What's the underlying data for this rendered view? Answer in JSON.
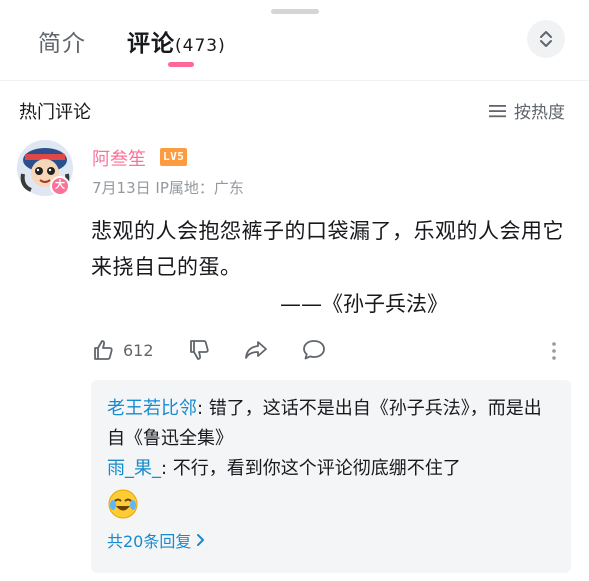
{
  "tabs": {
    "intro_label": "简介",
    "comments_label": "评论",
    "comments_count": "(473)"
  },
  "section": {
    "title": "热门评论",
    "sort_label": "按热度",
    "sort_icon": "list-icon"
  },
  "comment": {
    "username": "阿叁笙",
    "level": "LV5",
    "date": "7月13日",
    "ip_location": "IP属地：广东",
    "text": "悲观的人会抱怨裤子的口袋漏了，乐观的人会用它来挠自己的蛋。",
    "signature": "——《孙子兵法》",
    "like_count": "612",
    "accent_color": "#fb7299"
  },
  "replies": {
    "items": [
      {
        "name": "老王若比邻",
        "text": ": 错了，这话不是出自《孙子兵法》，而是出自《鲁迅全集》"
      },
      {
        "name": "雨_果_",
        "text": ": 不行，看到你这个评论彻底绷不住了"
      }
    ],
    "emoji": "crying-laughing-emoji",
    "more_label": "共20条回复"
  }
}
